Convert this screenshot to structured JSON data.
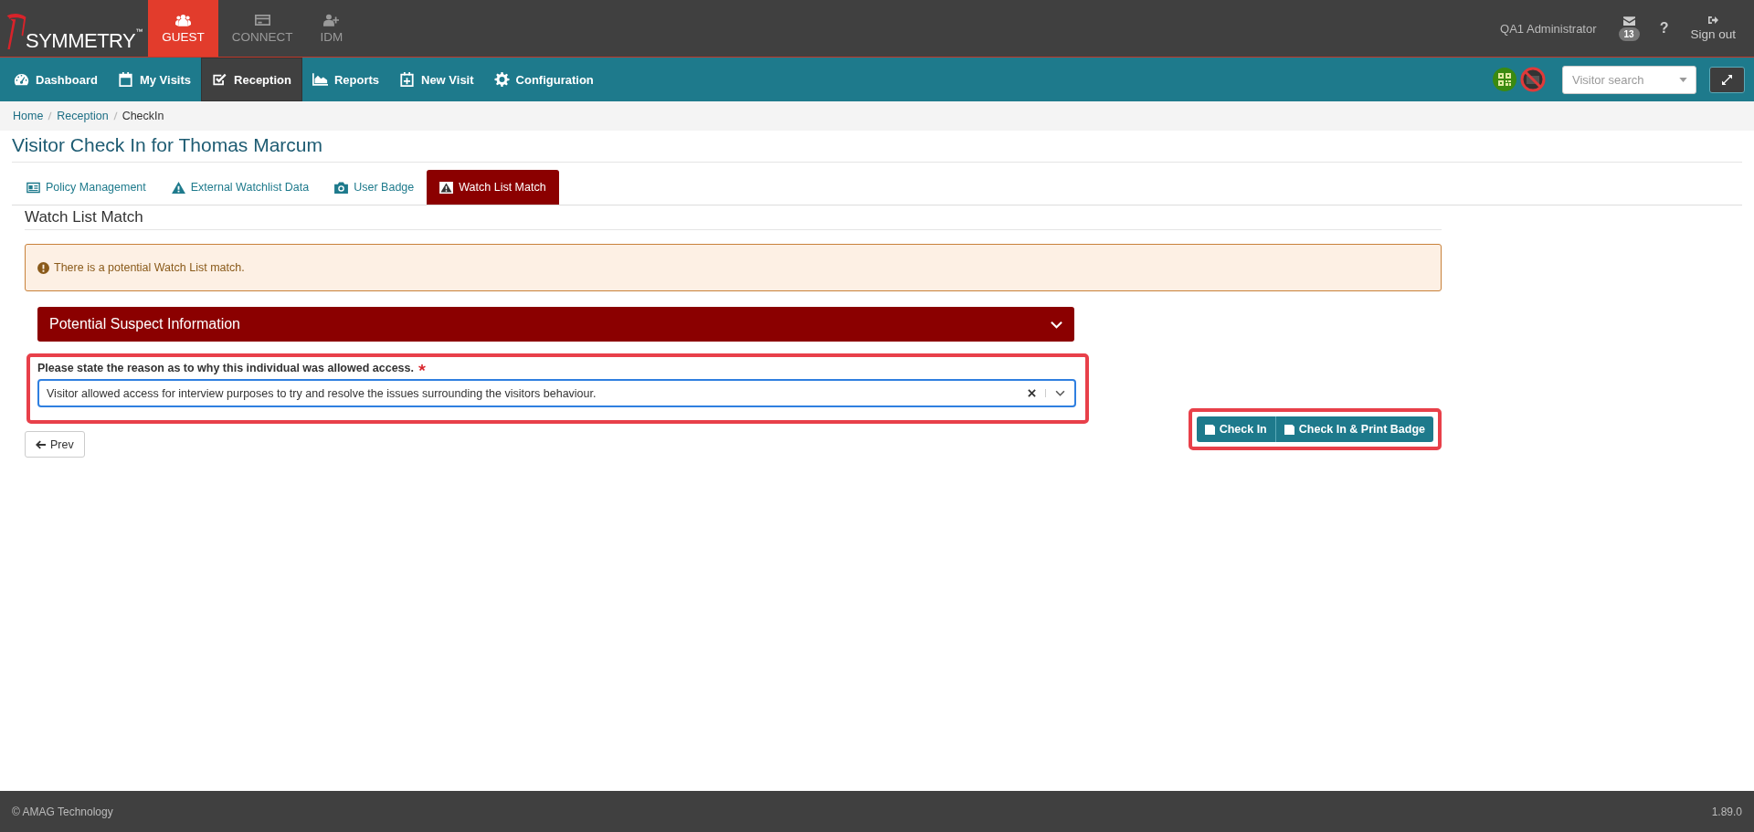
{
  "brand": {
    "logo_text": "SYMMETRY",
    "trademark": "™"
  },
  "apps": [
    {
      "label": "GUEST",
      "kind": "guest",
      "selected": true
    },
    {
      "label": "CONNECT",
      "kind": "card",
      "selected": false
    },
    {
      "label": "IDM",
      "kind": "user-add",
      "selected": false
    }
  ],
  "user": {
    "name": "QA1 Administrator",
    "messages_count": "13",
    "help": "?",
    "sign_out": "Sign out"
  },
  "nav": [
    {
      "label": "Dashboard",
      "kind": "dashboard",
      "selected": false
    },
    {
      "label": "My Visits",
      "kind": "calendar",
      "selected": false
    },
    {
      "label": "Reception",
      "kind": "check",
      "selected": true
    },
    {
      "label": "Reports",
      "kind": "chart",
      "selected": false
    },
    {
      "label": "New Visit",
      "kind": "calendar-plus",
      "selected": false
    },
    {
      "label": "Configuration",
      "kind": "gear",
      "selected": false
    }
  ],
  "visitor_search": {
    "placeholder": "Visitor search"
  },
  "breadcrumb": [
    "Home",
    "Reception",
    "CheckIn"
  ],
  "page_title": "Visitor Check In for Thomas Marcum",
  "tabs": [
    {
      "label": "Policy Management",
      "kind": "id-card",
      "selected": false
    },
    {
      "label": "External Watchlist Data",
      "kind": "warning",
      "selected": false
    },
    {
      "label": "User Badge",
      "kind": "camera",
      "selected": false
    },
    {
      "label": "Watch List Match",
      "kind": "warning-box",
      "selected": true
    }
  ],
  "section_title": "Watch List Match",
  "alert": {
    "text": "There is a potential Watch List match."
  },
  "panel": {
    "title": "Potential Suspect Information",
    "expanded": false
  },
  "reason_field": {
    "label": "Please state the reason as to why this individual was allowed access.",
    "required": true,
    "value": "Visitor allowed access for interview purposes to try and resolve the issues surrounding the visitors behaviour."
  },
  "prev_button": "Prev",
  "actions": [
    "Check In",
    "Check In & Print Badge"
  ],
  "footer": {
    "copyright": "© AMAG Technology",
    "version": "1.89.0"
  }
}
